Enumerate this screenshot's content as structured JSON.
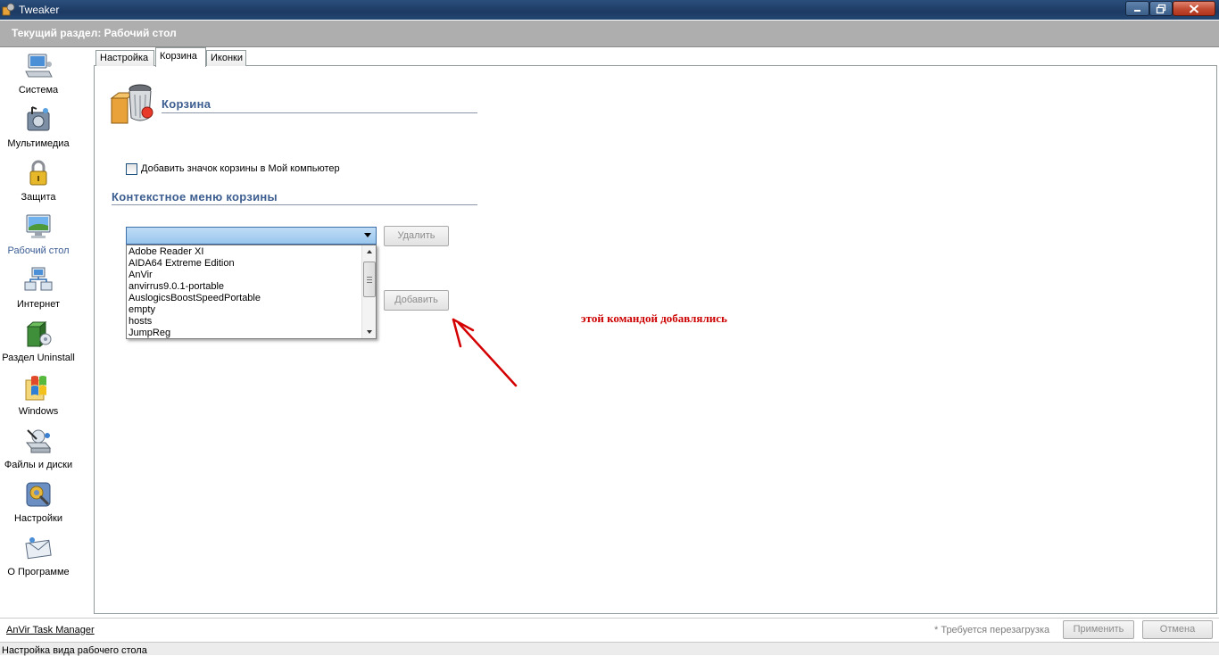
{
  "window": {
    "title": "Tweaker"
  },
  "section": {
    "label": "Текущий раздел:  Рабочий стол"
  },
  "sidebar": {
    "items": [
      {
        "label": "Система",
        "icon": "computer-icon"
      },
      {
        "label": "Мультимедиа",
        "icon": "multimedia-icon"
      },
      {
        "label": "Защита",
        "icon": "lock-icon"
      },
      {
        "label": "Рабочий стол",
        "icon": "desktop-icon",
        "active": true
      },
      {
        "label": "Интернет",
        "icon": "network-icon"
      },
      {
        "label": "Раздел Uninstall",
        "icon": "uninstall-icon"
      },
      {
        "label": "Windows",
        "icon": "windows-icon"
      },
      {
        "label": "Файлы и диски",
        "icon": "files-disks-icon"
      },
      {
        "label": "Настройки",
        "icon": "settings-icon"
      },
      {
        "label": "О Программе",
        "icon": "about-icon"
      }
    ]
  },
  "tabs": [
    {
      "label": "Настройка"
    },
    {
      "label": "Корзина",
      "active": true
    },
    {
      "label": "Иконки"
    }
  ],
  "recycle": {
    "heading": "Корзина",
    "checkbox_label": "Добавить значок корзины  в Мой компьютер",
    "checkbox_checked": false
  },
  "context_menu": {
    "heading": "Контекстное меню корзины",
    "combo_value": "",
    "items": [
      "Adobe Reader XI",
      "AIDA64 Extreme Edition",
      "AnVir",
      "anvirrus9.0.1-portable",
      "AuslogicsBoostSpeedPortable",
      "empty",
      "hosts",
      "JumpReg"
    ],
    "delete_label": "Удалить",
    "add_label": "Добавить"
  },
  "annotation": {
    "text": "этой командой добавлялись",
    "color": "#cc0000"
  },
  "footer": {
    "taskmgr_link": "AnVir Task Manager",
    "restart_note": "* Требуется перезагрузка",
    "apply_label": "Применить",
    "cancel_label": "Отмена"
  },
  "status": {
    "text": "Настройка вида рабочего стола"
  }
}
